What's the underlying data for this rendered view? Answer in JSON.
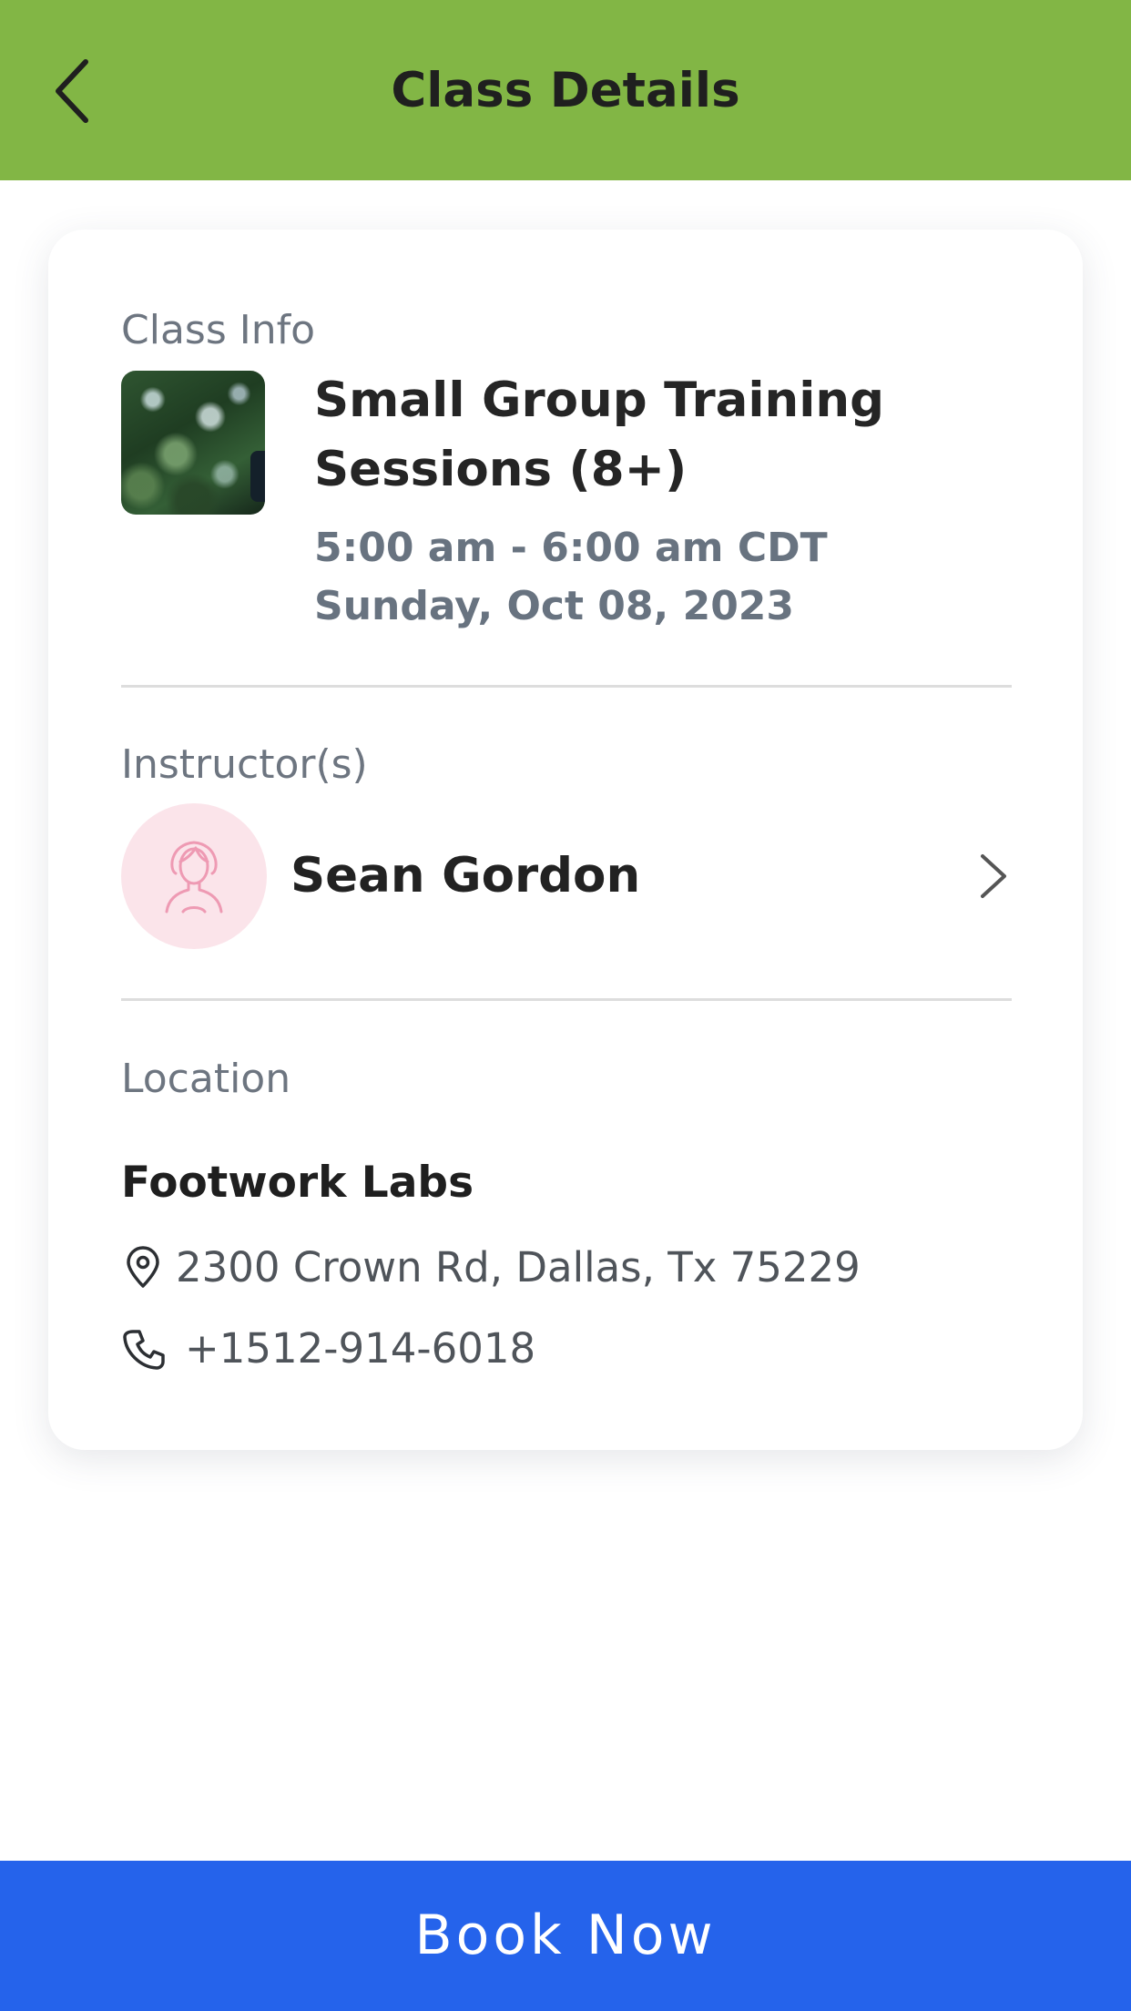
{
  "header": {
    "title": "Class Details",
    "back_icon": "chevron-left-icon",
    "background_color": "#82b645"
  },
  "class_info": {
    "label": "Class Info",
    "name": "Small Group Training Sessions (8+)",
    "time": "5:00 am - 6:00 am CDT",
    "date": "Sunday, Oct 08, 2023"
  },
  "instructors": {
    "label": "Instructor(s)",
    "items": [
      {
        "name": "Sean Gordon",
        "avatar_icon": "person-avatar-icon"
      }
    ]
  },
  "location": {
    "label": "Location",
    "venue": "Footwork Labs",
    "address": "2300 Crown Rd, Dallas, Tx 75229",
    "phone": "+1512-914-6018",
    "address_icon": "map-pin-icon",
    "phone_icon": "phone-icon"
  },
  "footer": {
    "book_label": "Book Now",
    "button_color": "#2563eb"
  }
}
